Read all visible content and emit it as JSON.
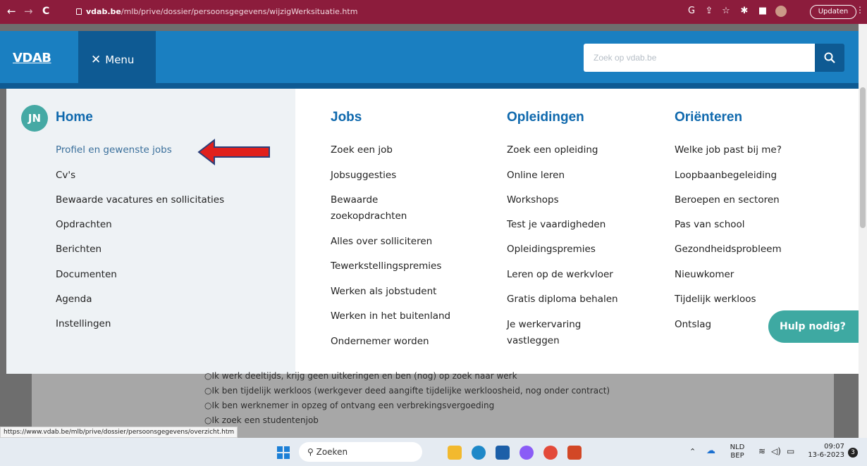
{
  "browser": {
    "url_host": "vdab.be",
    "url_path": "/mlb/prive/dossier/persoonsgegevens/wijzigWerksituatie.htm",
    "update_label": "Updaten"
  },
  "header": {
    "logo": "VDAB",
    "menu_label": "Menu",
    "search_placeholder": "Zoek op vdab.be"
  },
  "menu": {
    "avatar": "JN",
    "home": {
      "title": "Home",
      "items": [
        "Profiel en gewenste jobs",
        "Cv's",
        "Bewaarde vacatures en sollicitaties",
        "Opdrachten",
        "Berichten",
        "Documenten",
        "Agenda",
        "Instellingen"
      ]
    },
    "jobs": {
      "title": "Jobs",
      "items": [
        "Zoek een job",
        "Jobsuggesties",
        "Bewaarde zoekopdrachten",
        "Alles over solliciteren",
        "Tewerkstellingspremies",
        "Werken als jobstudent",
        "Werken in het buitenland",
        "Ondernemer worden"
      ]
    },
    "opleidingen": {
      "title": "Opleidingen",
      "items": [
        "Zoek een opleiding",
        "Online leren",
        "Workshops",
        "Test je vaardigheden",
        "Opleidingspremies",
        "Leren op de werkvloer",
        "Gratis diploma behalen",
        "Je werkervaring vastleggen"
      ]
    },
    "orienteren": {
      "title": "Oriënteren",
      "items": [
        "Welke job past bij me?",
        "Loopbaanbegeleiding",
        "Beroepen en sectoren",
        "Pas van school",
        "Gezondheidsprobleem",
        "Nieuwkomer",
        "Tijdelijk werkloos",
        "Ontslag"
      ]
    }
  },
  "background_form": {
    "options": [
      "Ik werk deeltijds, krijg geen uitkeringen en ben (nog) op zoek naar werk",
      "Ik ben tijdelijk werkloos (werkgever deed aangifte tijdelijke werkloosheid, nog onder contract)",
      "Ik ben werknemer in opzeg of ontvang een verbrekingsvergoeding",
      "Ik zoek een studentenjob"
    ]
  },
  "help_button": "Hulp nodig?",
  "status_url": "https://www.vdab.be/mlb/prive/dossier/persoonsgegevens/overzicht.htm",
  "taskbar": {
    "search_label": "Zoeken",
    "lang_top": "NLD",
    "lang_bottom": "BEP",
    "time": "09:07",
    "date": "13-6-2023",
    "notifications": "3"
  },
  "colors": {
    "brand_blue": "#1a7fc1",
    "dark_blue": "#0e5a93",
    "help_teal": "#3ea9a2",
    "arrow_red": "#e0201c",
    "chrome_bar": "#8c1c3c"
  }
}
